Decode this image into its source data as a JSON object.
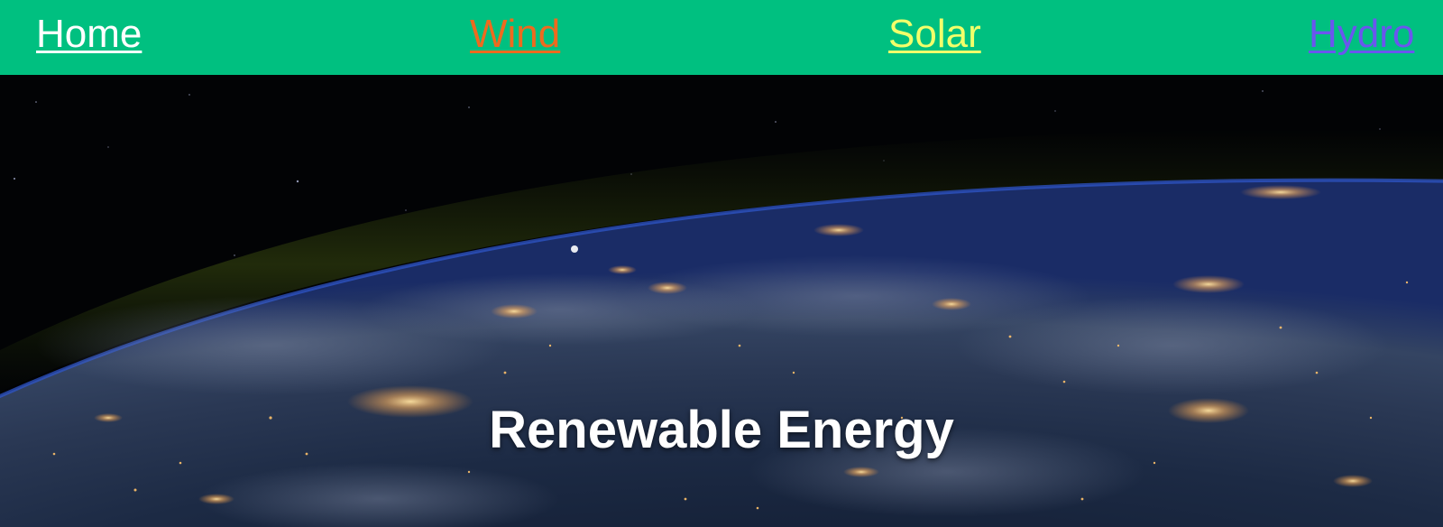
{
  "nav": {
    "items": [
      {
        "label": "Home",
        "color": "#ffffff"
      },
      {
        "label": "Wind",
        "color": "#ee6a1e"
      },
      {
        "label": "Solar",
        "color": "#f2ff6a"
      },
      {
        "label": "Hydro",
        "color": "#6a56ee"
      }
    ],
    "background": "#00c080"
  },
  "hero": {
    "title": "Renewable Energy",
    "image": "earth-at-night-from-orbit"
  }
}
